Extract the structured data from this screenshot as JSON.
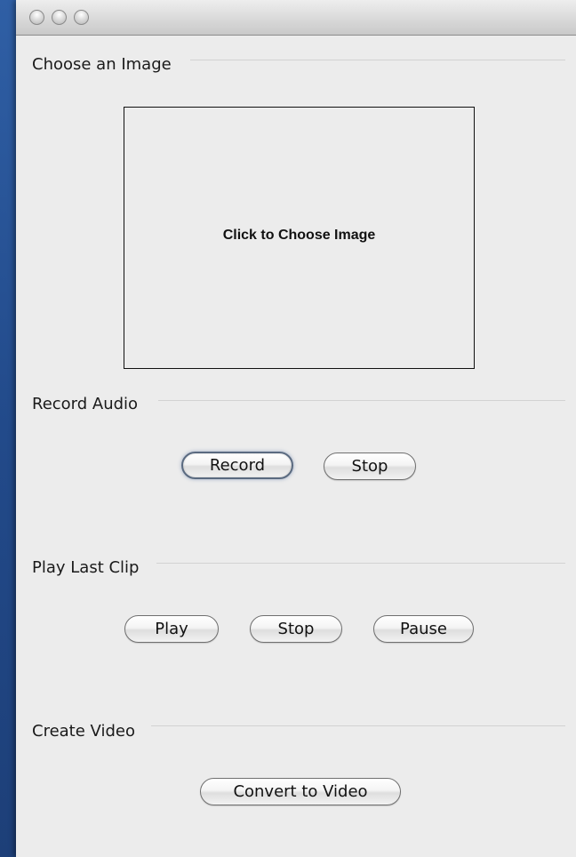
{
  "window": {
    "controls": [
      "close",
      "minimize",
      "zoom"
    ]
  },
  "sections": {
    "image": {
      "label": "Choose an Image",
      "chooser_text": "Click to Choose Image"
    },
    "record": {
      "label": "Record Audio",
      "record_button": "Record",
      "stop_button": "Stop"
    },
    "play": {
      "label": "Play Last Clip",
      "play_button": "Play",
      "stop_button": "Stop",
      "pause_button": "Pause"
    },
    "video": {
      "label": "Create Video",
      "convert_button": "Convert to Video"
    }
  },
  "colors": {
    "window_background": "#ececec",
    "desktop": "#224a8a"
  }
}
